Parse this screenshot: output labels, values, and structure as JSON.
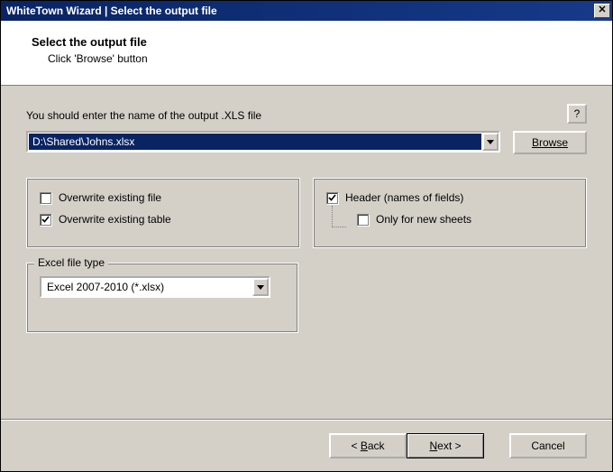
{
  "titlebar": {
    "text": "WhiteTown Wizard | Select the output file"
  },
  "header": {
    "heading": "Select the output file",
    "subtext": "Click 'Browse' button"
  },
  "content": {
    "instruction": "You should enter the name of the output .XLS file",
    "help_label": "?",
    "path_value": "D:\\Shared\\Johns.xlsx",
    "browse_label_u": "B",
    "browse_label_rest": "rowse"
  },
  "options": {
    "overwrite_file": {
      "label": "Overwrite existing file",
      "checked": false
    },
    "overwrite_table": {
      "label": "Overwrite existing table",
      "checked": true
    },
    "header_fields": {
      "label": "Header (names of fields)",
      "checked": true
    },
    "only_new_sheets": {
      "label": "Only for new sheets",
      "checked": false
    }
  },
  "filetype": {
    "legend": "Excel file type",
    "selected": "Excel 2007-2010 (*.xlsx)"
  },
  "footer": {
    "back_u": "B",
    "back_rest": "ack",
    "next_u": "N",
    "next_rest": "ext >",
    "cancel": "Cancel"
  }
}
